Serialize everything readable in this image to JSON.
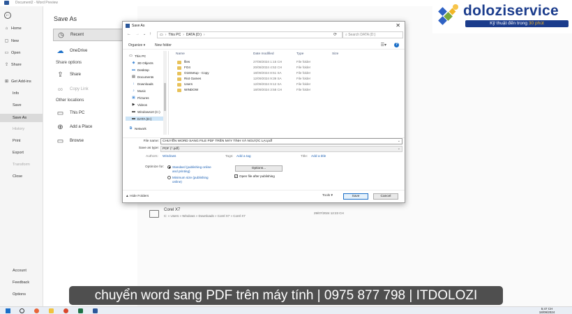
{
  "window": {
    "title": "Document2 - Word Preview"
  },
  "nav": {
    "back_glyph": "←",
    "items": [
      {
        "label": "Home",
        "icon": "⌂"
      },
      {
        "label": "New",
        "icon": "▢"
      },
      {
        "label": "Open",
        "icon": "▭"
      },
      {
        "label": "Share",
        "icon": "⇪"
      },
      {
        "label": "Get Add-ins",
        "icon": "⊞"
      },
      {
        "label": "Info"
      },
      {
        "label": "Save"
      },
      {
        "label": "Save As"
      },
      {
        "label": "History"
      },
      {
        "label": "Print"
      },
      {
        "label": "Export"
      },
      {
        "label": "Transform"
      },
      {
        "label": "Close"
      }
    ],
    "bottom": [
      {
        "label": "Account"
      },
      {
        "label": "Feedback"
      },
      {
        "label": "Options"
      }
    ]
  },
  "middle": {
    "heading": "Save As",
    "recent": "Recent",
    "onedrive": "OneDrive",
    "share_options": "Share options",
    "share": "Share",
    "copy_link": "Copy Link",
    "other_locations": "Other locations",
    "this_pc": "This PC",
    "add_place": "Add a Place",
    "browse": "Browse"
  },
  "recent_file": {
    "name": "Corel X7",
    "path": "C: » Users » Windows » Downloads » Corel X7 » Corel X7",
    "date": "29/07/2024 12:23 CH"
  },
  "dialog": {
    "title": "Save As",
    "close": "✕",
    "breadcrumb": [
      "This PC",
      "DATA (D:)"
    ],
    "search_placeholder": "Search DATA (D:)",
    "organize": "Organize ▾",
    "new_folder": "New folder",
    "help": "?",
    "tree": [
      {
        "label": "This PC",
        "icon": "▭"
      },
      {
        "label": "3D Objects",
        "icon": "◆"
      },
      {
        "label": "Desktop",
        "icon": "▬"
      },
      {
        "label": "Documents",
        "icon": "▤"
      },
      {
        "label": "Downloads",
        "icon": "↓"
      },
      {
        "label": "Music",
        "icon": "♪"
      },
      {
        "label": "Pictures",
        "icon": "▣"
      },
      {
        "label": "Videos",
        "icon": "▶"
      },
      {
        "label": "Windows10 (C:)",
        "icon": "▬"
      },
      {
        "label": "DATA (D:)",
        "icon": "▬"
      },
      {
        "label": "Network",
        "icon": "⧉"
      }
    ],
    "columns": [
      "Name",
      "Date modified",
      "Type",
      "Size"
    ],
    "files": [
      {
        "name": "files",
        "date": "27/08/2024 1:15 CH",
        "type": "File folder"
      },
      {
        "name": "FO4",
        "date": "20/08/2024 4:53 CH",
        "type": "File folder"
      },
      {
        "name": "O16Setup - Copy",
        "date": "18/09/2024 8:51 SA",
        "type": "File folder"
      },
      {
        "name": "Riot Games",
        "date": "12/09/2024 9:39 SA",
        "type": "File folder"
      },
      {
        "name": "Users",
        "date": "12/09/2024 9:12 SA",
        "type": "File folder"
      },
      {
        "name": "WINDOW",
        "date": "18/09/2024 3:58 CH",
        "type": "File folder"
      }
    ],
    "file_name_label": "File name:",
    "file_name_value": "CHUYỂN WORD SANG FILE PDF TRÊN MÁY TÍNH VÀ NGƯỢC LẠI.pdf",
    "save_type_label": "Save as type:",
    "save_type_value": "PDF (*.pdf)",
    "authors_label": "Authors:",
    "authors_value": "Windows",
    "tags_label": "Tags:",
    "tags_value": "Add a tag",
    "title_label": "Title:",
    "title_value": "Add a title",
    "optimize_label": "Optimize for:",
    "opt_standard": "Standard (publishing online and printing)",
    "opt_minimum": "Minimum size (publishing online)",
    "options_btn": "Options...",
    "open_after": "Open file after publishing",
    "hide_folders": "▲ Hide Folders",
    "tools": "Tools ▾",
    "save": "Save",
    "cancel": "Cancel"
  },
  "logo": {
    "brand": "doloziservice",
    "tagline_prefix": "Kỹ thuật đến trong ",
    "tagline_accent": "30 phút"
  },
  "caption": "chuyển word sang PDF trên máy tính | 0975 877 798 | ITDOLOZI",
  "taskbar": {
    "time": "5:47 CH",
    "date": "18/09/2024"
  }
}
